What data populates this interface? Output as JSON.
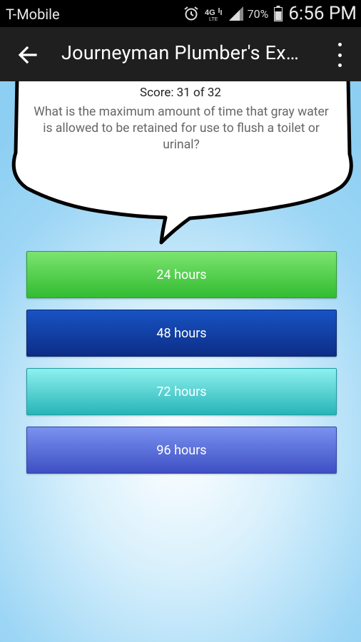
{
  "status_bar": {
    "carrier": "T-Mobile",
    "battery_percent": "70%",
    "time": "6:56 PM",
    "icons": [
      "alarm-icon",
      "lte-icon",
      "signal-icon",
      "battery-icon"
    ]
  },
  "app_bar": {
    "title": "Journeyman Plumber's Ex…",
    "back_icon": "arrow-back-icon",
    "menu_icon": "overflow-menu-icon"
  },
  "quiz": {
    "score": "Score: 31 of 32",
    "question": "What is the maximum amount of time that gray water is allowed to be retained for use to flush a toilet or urinal?",
    "answers": [
      {
        "label": "24 hours",
        "color": "#4fcf47"
      },
      {
        "label": "48 hours",
        "color": "#103a9e"
      },
      {
        "label": "72 hours",
        "color": "#58d6d6"
      },
      {
        "label": "96 hours",
        "color": "#5b6fdb"
      }
    ]
  }
}
